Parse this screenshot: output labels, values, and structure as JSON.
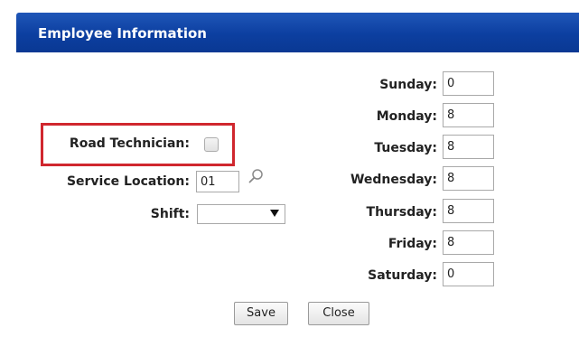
{
  "dialog": {
    "title": "Employee Information"
  },
  "left": {
    "road_technician_label": "Road Technician:",
    "road_technician_checked": false,
    "service_location_label": "Service Location:",
    "service_location_value": "01",
    "lookup_icon": "magnifier-icon",
    "shift_label": "Shift:",
    "shift_value": ""
  },
  "hours": [
    {
      "label": "Sunday:",
      "value": "0"
    },
    {
      "label": "Monday:",
      "value": "8"
    },
    {
      "label": "Tuesday:",
      "value": "8"
    },
    {
      "label": "Wednesday:",
      "value": "8"
    },
    {
      "label": "Thursday:",
      "value": "8"
    },
    {
      "label": "Friday:",
      "value": "8"
    },
    {
      "label": "Saturday:",
      "value": "0"
    }
  ],
  "buttons": {
    "save_label": "Save",
    "close_label": "Close"
  },
  "colors": {
    "title_bar": "#0c3fa0",
    "highlight": "#d0272e"
  }
}
